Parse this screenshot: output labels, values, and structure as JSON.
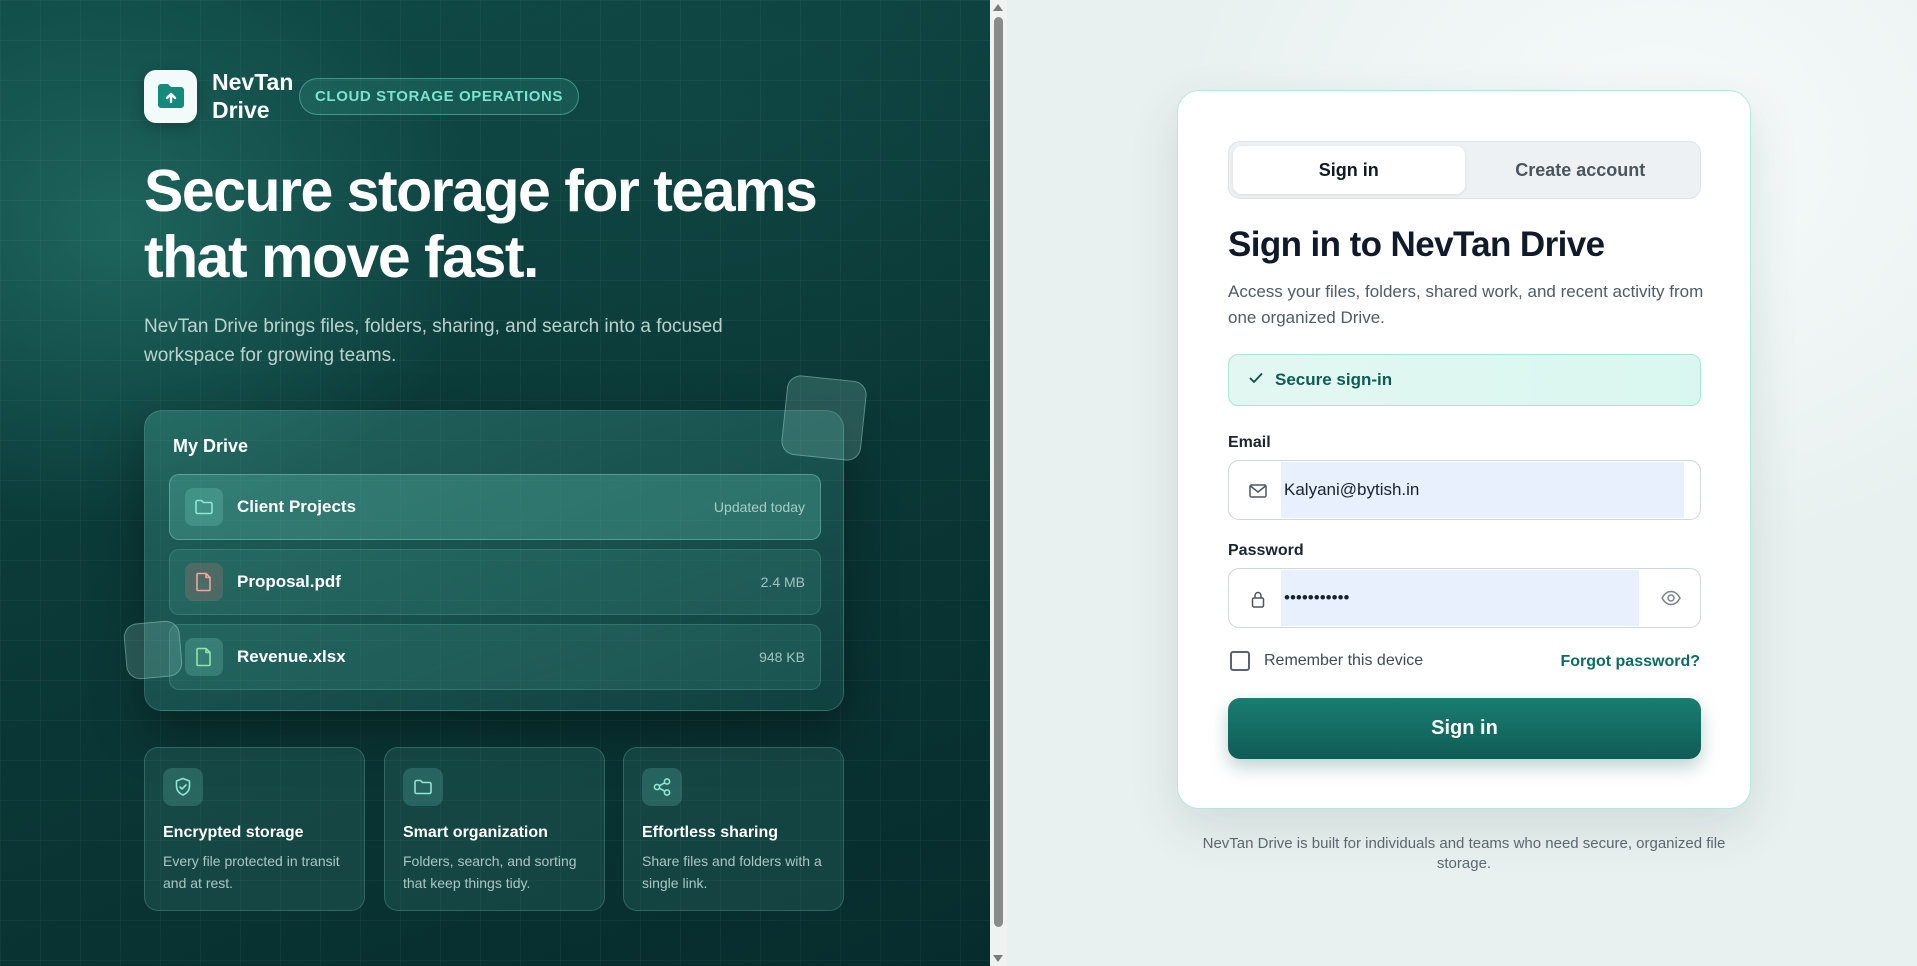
{
  "brand": {
    "name": "NevTan Drive",
    "tagline": "CLOUD STORAGE OPERATIONS"
  },
  "hero": {
    "title": "Secure storage for teams that move fast.",
    "subtitle": "NevTan Drive brings files, folders, sharing, and search into a focused workspace for growing teams."
  },
  "drive_preview": {
    "title": "My Drive",
    "files": [
      {
        "name": "Client Projects",
        "meta": "Updated today",
        "icon": "folder-icon"
      },
      {
        "name": "Proposal.pdf",
        "meta": "2.4 MB",
        "icon": "pdf-file-icon"
      },
      {
        "name": "Revenue.xlsx",
        "meta": "948 KB",
        "icon": "spreadsheet-file-icon"
      }
    ]
  },
  "features": [
    {
      "title": "Encrypted storage",
      "desc": "Every file protected in transit and at rest.",
      "icon": "shield-check-icon"
    },
    {
      "title": "Smart organization",
      "desc": "Folders, search, and sorting that keep things tidy.",
      "icon": "folder-icon"
    },
    {
      "title": "Effortless sharing",
      "desc": "Share files and folders with a single link.",
      "icon": "share-icon"
    }
  ],
  "auth": {
    "tabs": [
      "Sign in",
      "Create account"
    ],
    "active_tab": "Sign in",
    "title": "Sign in to NevTan Drive",
    "subtitle": "Access your files, folders, shared work, and recent activity from one organized Drive.",
    "secure_label": "Secure sign-in",
    "email_label": "Email",
    "email_value": "Kalyani@bytish.in",
    "password_label": "Password",
    "password_value": "•••••••••••",
    "remember_label": "Remember this device",
    "remember_checked": false,
    "forgot_label": "Forgot password?",
    "submit_label": "Sign in"
  },
  "footnote": "NevTan Drive is built for individuals and teams who need secure, organized file storage.",
  "colors": {
    "brand_dark": "#0b3a38",
    "accent": "#0e6b62",
    "accent_light": "#7be3cf"
  }
}
